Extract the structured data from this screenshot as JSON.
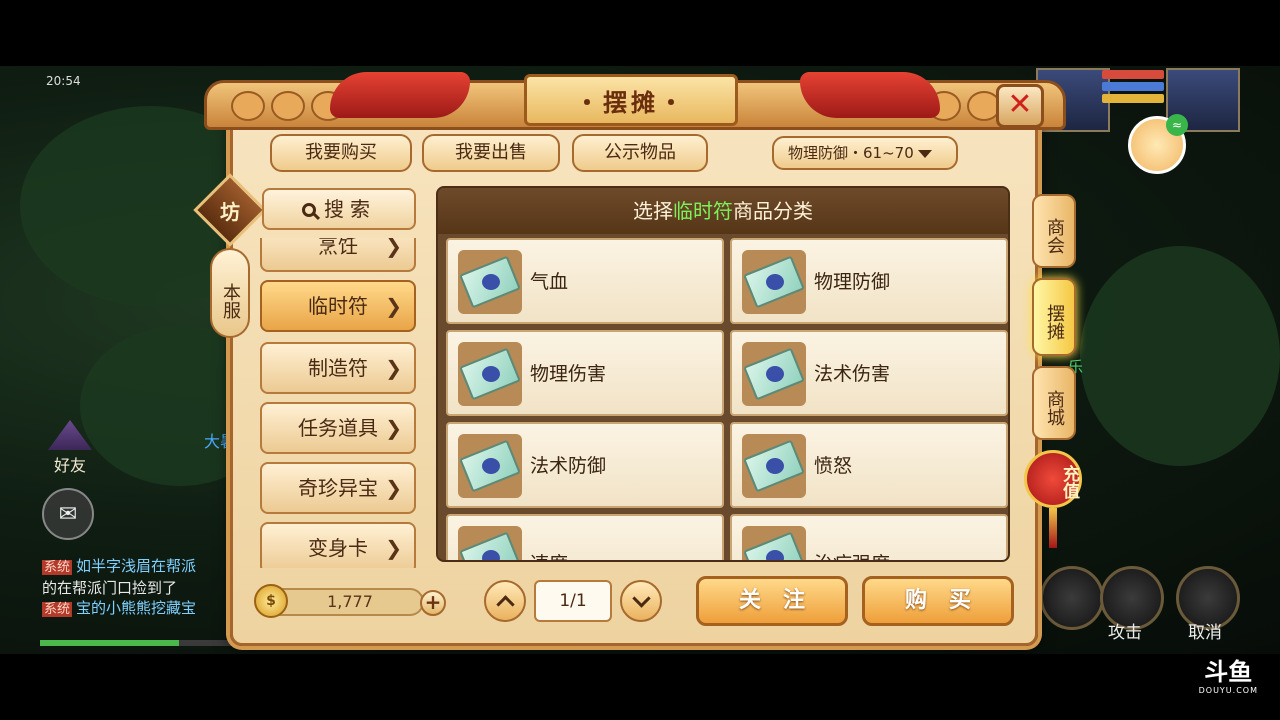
{
  "status": {
    "time": "20:54"
  },
  "window": {
    "title": "摆摊",
    "close_label": "✕"
  },
  "top_tabs": [
    {
      "label": "我要购买"
    },
    {
      "label": "我要出售"
    },
    {
      "label": "公示物品"
    }
  ],
  "filter": {
    "selected": "物理防御・61~70"
  },
  "side_badge": {
    "label": "坊"
  },
  "server_tag": {
    "label": "本服"
  },
  "search": {
    "label": "搜索"
  },
  "categories": [
    {
      "label": "烹饪"
    },
    {
      "label": "临时符",
      "active": true
    },
    {
      "label": "制造符"
    },
    {
      "label": "任务道具"
    },
    {
      "label": "奇珍异宝"
    },
    {
      "label": "变身卡"
    }
  ],
  "grid": {
    "header_prefix": "选择",
    "header_highlight": "临时符",
    "header_suffix": "商品分类",
    "items": [
      {
        "label": "气血"
      },
      {
        "label": "物理防御"
      },
      {
        "label": "物理伤害"
      },
      {
        "label": "法术伤害"
      },
      {
        "label": "法术防御"
      },
      {
        "label": "愤怒"
      },
      {
        "label": "速度"
      },
      {
        "label": "治疗强度"
      }
    ]
  },
  "footer": {
    "coins": "1,777",
    "plus_label": "+",
    "page": "1/1",
    "follow_label": "关注",
    "buy_label": "购买"
  },
  "right_menu": [
    {
      "label": "商会"
    },
    {
      "label": "摆摊",
      "active": true
    },
    {
      "label": "商城"
    }
  ],
  "recharge": {
    "label": "充值"
  },
  "hud": {
    "friend_label": "好友",
    "attack_label": "攻击",
    "cancel_label": "取消",
    "da_label": "大暑"
  },
  "chat": [
    {
      "tag": "系统",
      "text": "如半字浅眉在帮派"
    },
    {
      "tag": "",
      "text": "的在帮派门口捡到了"
    },
    {
      "tag": "系统",
      "text": "宝的小熊熊挖藏宝"
    }
  ],
  "watermark": {
    "main": "斗鱼",
    "sub": "DOUYU.COM"
  },
  "colors": {
    "accent_green": "#7cf15a",
    "panel_bg": "#f7e4bf",
    "frame_brown": "#a5652c"
  }
}
